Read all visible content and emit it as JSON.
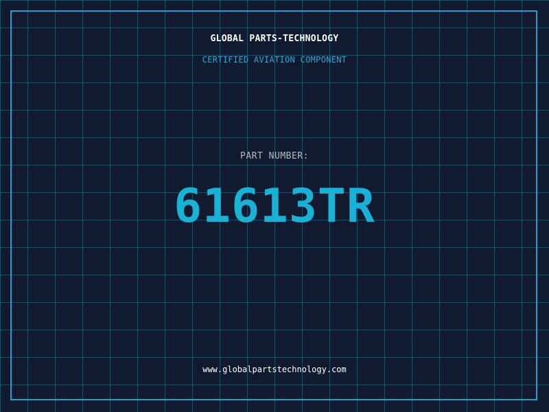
{
  "header": {
    "company": "GLOBAL PARTS-TECHNOLOGY",
    "subtitle": "CERTIFIED AVIATION COMPONENT"
  },
  "main": {
    "label": "PART NUMBER:",
    "part_number": "61613TR"
  },
  "footer": {
    "url": "www.globalpartstechnology.com"
  },
  "colors": {
    "background": "#111a2e",
    "grid": "#26789a",
    "accent": "#17b2d6",
    "frame": "#1fa3cc"
  }
}
